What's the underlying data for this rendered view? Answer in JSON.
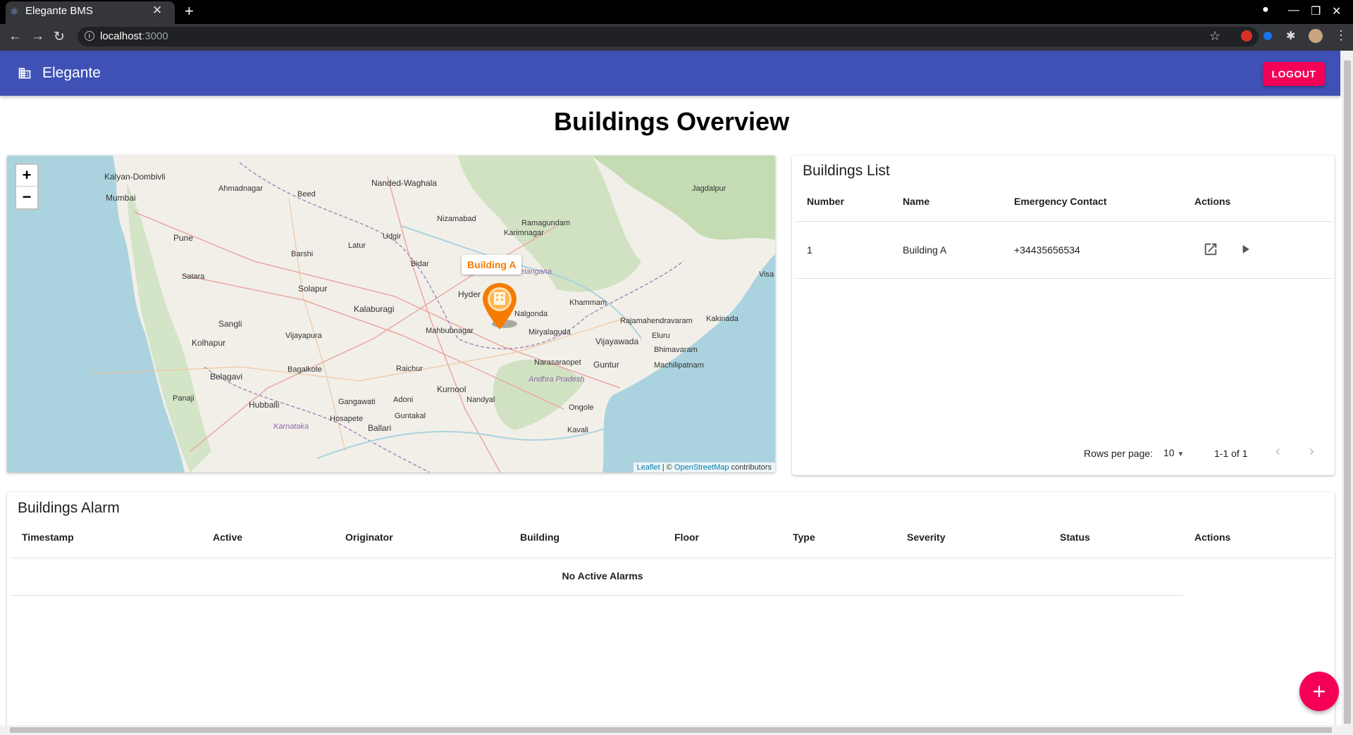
{
  "browser": {
    "tab_title": "Elegante BMS",
    "url_host": "localhost",
    "url_port": ":3000"
  },
  "appbar": {
    "title": "Elegante",
    "logout_label": "LOGOUT",
    "color": "#3f51b5",
    "accent": "#f50057"
  },
  "page": {
    "title": "Buildings Overview"
  },
  "map": {
    "zoom_in": "+",
    "zoom_out": "−",
    "marker_popup": "Building A",
    "attribution_leaflet": "Leaflet",
    "attribution_sep": " | © ",
    "attribution_osm": "OpenStreetMap",
    "attribution_tail": " contributors",
    "places": [
      "Kalyan-Dombivli",
      "Mumbai",
      "Ahmadnagar",
      "Beed",
      "Nanded-Waghala",
      "Jagdalpur",
      "Nizamabad",
      "Ramagundam",
      "Karimnagar",
      "Udgir",
      "Pune",
      "Latur",
      "Barshi",
      "Bidar",
      "Telangana",
      "Satara",
      "Solapur",
      "Hyder",
      "Kalaburagi",
      "Visa",
      "Khammam",
      "Nalgonda",
      "Sangli",
      "Vijayapura",
      "Mahbubnagar",
      "Miryalaguda",
      "Rajamahendravaram",
      "Kakinada",
      "Eluru",
      "Kolhapur",
      "Vijayawada",
      "Bhimavaram",
      "Bagalkote",
      "Narasaraopet",
      "Guntur",
      "Machilipatnam",
      "Belagavi",
      "Raichur",
      "Andhra Pradesh",
      "Kurnool",
      "Panaji",
      "Hubballi",
      "Gangawati",
      "Adoni",
      "Nandyal",
      "Ongole",
      "Hosapete",
      "Guntakal",
      "Karnataka",
      "Ballari",
      "Kavali"
    ]
  },
  "buildings_list": {
    "title": "Buildings List",
    "columns": [
      "Number",
      "Name",
      "Emergency Contact",
      "Actions"
    ],
    "rows": [
      {
        "number": "1",
        "name": "Building A",
        "contact": "+34435656534"
      }
    ],
    "rows_per_page_label": "Rows per page:",
    "rows_per_page": "10",
    "range": "1-1 of 1"
  },
  "alarms": {
    "title": "Buildings Alarm",
    "columns": [
      "Timestamp",
      "Active",
      "Originator",
      "Building",
      "Floor",
      "Type",
      "Severity",
      "Status",
      "Actions"
    ],
    "empty": "No Active Alarms"
  },
  "fab_label": "+"
}
